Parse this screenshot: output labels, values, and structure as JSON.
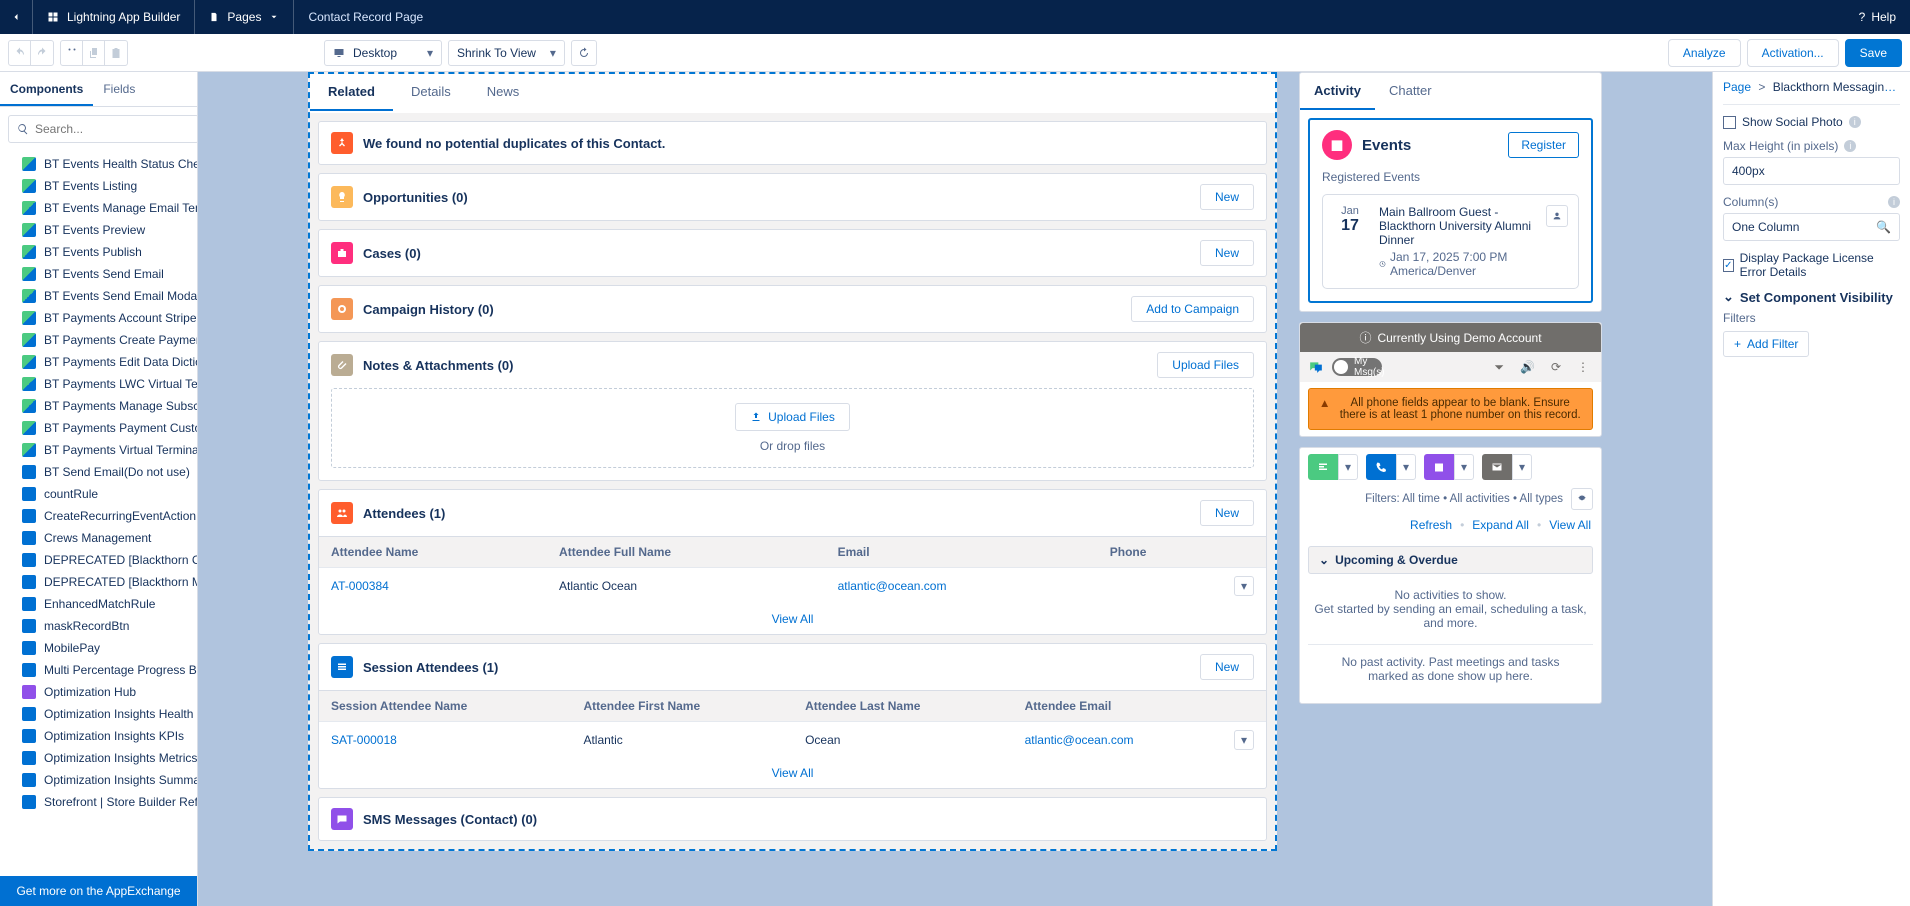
{
  "header": {
    "app_builder": "Lightning App Builder",
    "pages": "Pages",
    "page_title": "Contact Record Page",
    "help": "Help"
  },
  "toolbar": {
    "device": "Desktop",
    "view": "Shrink To View",
    "analyze": "Analyze",
    "activation": "Activation...",
    "save": "Save"
  },
  "left": {
    "tab_components": "Components",
    "tab_fields": "Fields",
    "search_ph": "Search...",
    "footer": "Get more on the AppExchange",
    "items": [
      {
        "l": "BT Events Health Status Check",
        "c": "green"
      },
      {
        "l": "BT Events Listing",
        "c": "green"
      },
      {
        "l": "BT Events Manage Email Template",
        "c": "green"
      },
      {
        "l": "BT Events Preview",
        "c": "green"
      },
      {
        "l": "BT Events Publish",
        "c": "green"
      },
      {
        "l": "BT Events Send Email",
        "c": "green"
      },
      {
        "l": "BT Events Send Email Modal",
        "c": "green"
      },
      {
        "l": "BT Payments Account Stripe Cus...",
        "c": "green"
      },
      {
        "l": "BT Payments Create Payment M...",
        "c": "green"
      },
      {
        "l": "BT Payments Edit Data Dictionary",
        "c": "green"
      },
      {
        "l": "BT Payments LWC Virtual Terminal",
        "c": "green"
      },
      {
        "l": "BT Payments Manage Subscripti...",
        "c": "green"
      },
      {
        "l": "BT Payments Payment Customer...",
        "c": "green"
      },
      {
        "l": "BT Payments Virtual Terminal",
        "c": "green"
      },
      {
        "l": "BT Send Email(Do not use)",
        "c": "blue"
      },
      {
        "l": "countRule",
        "c": "blue"
      },
      {
        "l": "CreateRecurringEventAction",
        "c": "blue"
      },
      {
        "l": "Crews Management",
        "c": "blue"
      },
      {
        "l": "DEPRECATED [Blackthorn Conve...",
        "c": "blue"
      },
      {
        "l": "DEPRECATED [Blackthorn Messa...",
        "c": "blue"
      },
      {
        "l": "EnhancedMatchRule",
        "c": "blue"
      },
      {
        "l": "maskRecordBtn",
        "c": "blue"
      },
      {
        "l": "MobilePay",
        "c": "blue"
      },
      {
        "l": "Multi Percentage Progress Bar",
        "c": "blue"
      },
      {
        "l": "Optimization Hub",
        "c": "purple"
      },
      {
        "l": "Optimization Insights Health Che...",
        "c": "blue"
      },
      {
        "l": "Optimization Insights KPIs",
        "c": "blue"
      },
      {
        "l": "Optimization Insights Metrics",
        "c": "blue"
      },
      {
        "l": "Optimization Insights Summary",
        "c": "blue"
      },
      {
        "l": "Storefront | Store Builder Refres...",
        "c": "blue"
      }
    ]
  },
  "record": {
    "tabs": {
      "related": "Related",
      "details": "Details",
      "news": "News"
    },
    "dup": {
      "title": "We found no potential duplicates of this Contact."
    },
    "opp": {
      "title": "Opportunities (0)",
      "new": "New"
    },
    "cases": {
      "title": "Cases (0)",
      "new": "New"
    },
    "campaign": {
      "title": "Campaign History (0)",
      "add": "Add to Campaign"
    },
    "notes": {
      "title": "Notes & Attachments (0)",
      "upload_btn": "Upload Files",
      "upload": "Upload Files",
      "drop": "Or drop files"
    },
    "attendees": {
      "title": "Attendees (1)",
      "new": "New",
      "cols": {
        "name": "Attendee Name",
        "full": "Attendee Full Name",
        "email": "Email",
        "phone": "Phone"
      },
      "row": {
        "name": "AT-000384",
        "full": "Atlantic Ocean",
        "email": "atlantic@ocean.com"
      },
      "view_all": "View All"
    },
    "sess": {
      "title": "Session Attendees (1)",
      "new": "New",
      "cols": {
        "name": "Session Attendee Name",
        "first": "Attendee First Name",
        "last": "Attendee Last Name",
        "email": "Attendee Email"
      },
      "row": {
        "name": "SAT-000018",
        "first": "Atlantic",
        "last": "Ocean",
        "email": "atlantic@ocean.com"
      },
      "view_all": "View All"
    },
    "sms": {
      "title": "SMS Messages (Contact) (0)"
    }
  },
  "side": {
    "tabs": {
      "activity": "Activity",
      "chatter": "Chatter"
    },
    "events": {
      "title": "Events",
      "register": "Register",
      "sub": "Registered Events",
      "month": "Jan",
      "day": "17",
      "event_title": "Main Ballroom Guest - Blackthorn University Alumni Dinner",
      "time": "Jan 17, 2025 7:00 PM America/Denver"
    },
    "demo": "Currently Using Demo Account",
    "toggle": "My Msg(s)",
    "warn": "All phone fields appear to be blank. Ensure there is at least 1 phone number on this record.",
    "filters": "Filters: All time • All activities • All types",
    "refresh": "Refresh",
    "expand": "Expand All",
    "view_all": "View All",
    "upover": "Upcoming & Overdue",
    "no_act_1": "No activities to show.",
    "no_act_2": "Get started by sending an email, scheduling a task, and more.",
    "no_past": "No past activity. Past meetings and tasks marked as done show up here."
  },
  "right": {
    "crumb_page": "Page",
    "crumb_comp": "Blackthorn Messaging Mes...",
    "show_social": "Show Social Photo",
    "max_h_lbl": "Max Height (in pixels)",
    "max_h_val": "400px",
    "cols_lbl": "Column(s)",
    "cols_val": "One Column",
    "pkg_err": "Display Package License Error Details",
    "vis_hd": "Set Component Visibility",
    "filters": "Filters",
    "add_filter": "Add Filter"
  },
  "colors": {
    "dup": "#ff5d2d",
    "opp": "#fcb95b",
    "cases": "#f2cf5b",
    "campaign": "#f49756",
    "notes": "#baac93",
    "attendees": "#ff5d2d",
    "sess": "#0070d2",
    "sms": "#9050e9"
  }
}
